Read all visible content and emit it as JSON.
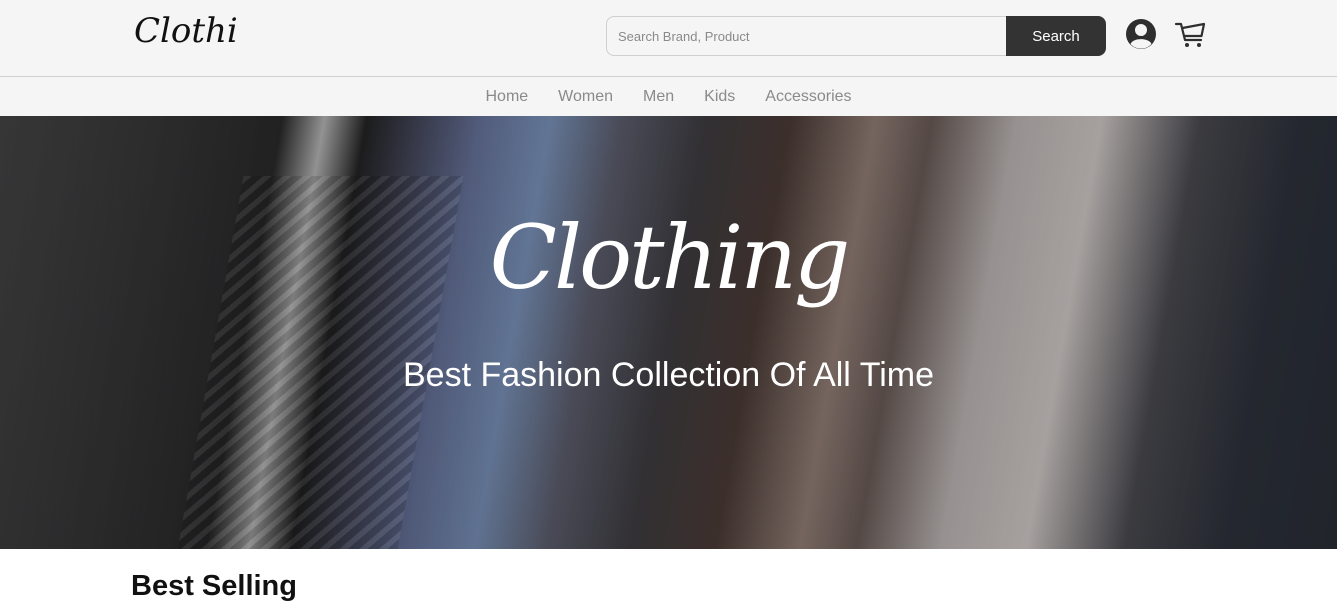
{
  "header": {
    "logo_text": "Clothing",
    "search": {
      "placeholder": "Search Brand, Product",
      "value": "",
      "button_label": "Search"
    },
    "icons": {
      "user": "user-icon",
      "cart": "cart-icon"
    }
  },
  "nav": {
    "items": [
      {
        "label": "Home"
      },
      {
        "label": "Women"
      },
      {
        "label": "Men"
      },
      {
        "label": "Kids"
      },
      {
        "label": "Accessories"
      }
    ]
  },
  "hero": {
    "logo_text": "Clothing",
    "tagline": "Best Fashion Collection Of All Time"
  },
  "sections": {
    "best_selling_title": "Best Selling"
  },
  "colors": {
    "topbar_bg": "#f5f5f5",
    "search_button_bg": "#333333",
    "nav_text": "#8a8a8a"
  }
}
